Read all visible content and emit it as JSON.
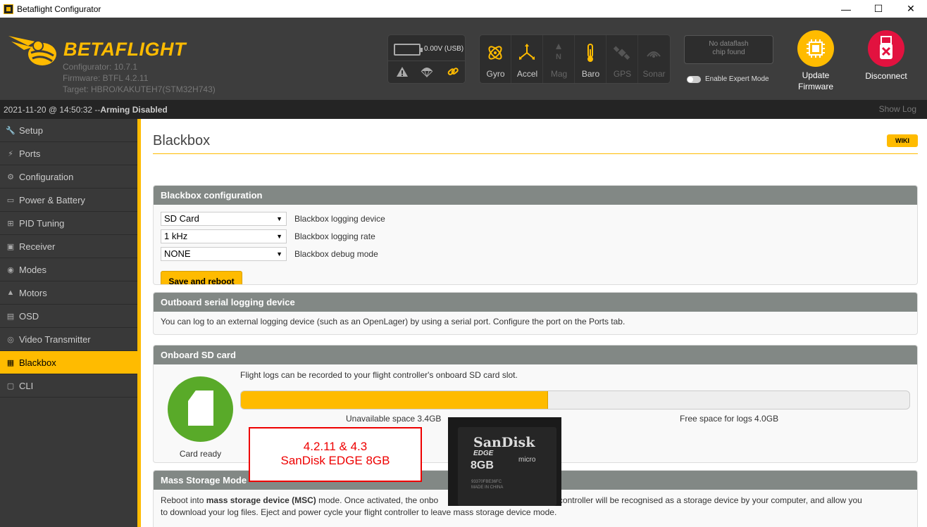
{
  "window": {
    "title": "Betaflight Configurator",
    "minimize": "—",
    "maximize": "☐",
    "close": "✕"
  },
  "header": {
    "logo_beta": "BETA",
    "logo_flight": "FLIGHT",
    "configurator": "Configurator: 10.7.1",
    "firmware": "Firmware: BTFL 4.2.11",
    "target": "Target: HBRO/KAKUTEH7(STM32H743)",
    "battery_voltage": "0.00V (USB)",
    "sensors": [
      {
        "label": "Gyro",
        "active": true
      },
      {
        "label": "Accel",
        "active": true
      },
      {
        "label": "Mag",
        "active": false
      },
      {
        "label": "Baro",
        "active": true
      },
      {
        "label": "GPS",
        "active": false
      },
      {
        "label": "Sonar",
        "active": false
      }
    ],
    "dataflash_line1": "No dataflash",
    "dataflash_line2": "chip found",
    "expert_mode": "Enable Expert Mode",
    "update_line1": "Update",
    "update_line2": "Firmware",
    "disconnect": "Disconnect"
  },
  "status": {
    "datetime": "2021-11-20 @ 14:50:32 -- ",
    "arming": "Arming Disabled",
    "show_log": "Show Log"
  },
  "sidebar": {
    "items": [
      {
        "label": "Setup",
        "icon": "wrench-icon"
      },
      {
        "label": "Ports",
        "icon": "plug-icon"
      },
      {
        "label": "Configuration",
        "icon": "gear-icon"
      },
      {
        "label": "Power & Battery",
        "icon": "battery-icon"
      },
      {
        "label": "PID Tuning",
        "icon": "sitemap-icon"
      },
      {
        "label": "Receiver",
        "icon": "receiver-icon"
      },
      {
        "label": "Modes",
        "icon": "toggles-icon"
      },
      {
        "label": "Motors",
        "icon": "motor-icon"
      },
      {
        "label": "OSD",
        "icon": "osd-icon"
      },
      {
        "label": "Video Transmitter",
        "icon": "broadcast-icon"
      },
      {
        "label": "Blackbox",
        "icon": "blackbox-icon"
      },
      {
        "label": "CLI",
        "icon": "terminal-icon"
      }
    ],
    "active": "Blackbox"
  },
  "main": {
    "title": "Blackbox",
    "wiki": "WIKI",
    "config": {
      "heading": "Blackbox configuration",
      "device_value": "SD Card",
      "device_label": "Blackbox logging device",
      "rate_value": "1 kHz",
      "rate_label": "Blackbox logging rate",
      "debug_value": "NONE",
      "debug_label": "Blackbox debug mode",
      "save_button": "Save and reboot"
    },
    "outboard": {
      "heading": "Outboard serial logging device",
      "text": "You can log to an external logging device (such as an OpenLager) by using a serial port. Configure the port on the Ports tab."
    },
    "sdcard": {
      "heading": "Onboard SD card",
      "text": "Flight logs can be recorded to your flight controller's onboard SD card slot.",
      "used_fraction": 0.4595,
      "unavailable": "Unavailable space 3.4GB",
      "free": "Free space for logs 4.0GB",
      "card_status": "Card ready"
    },
    "msc": {
      "heading": "Mass Storage Mode",
      "text_pre": "Reboot into ",
      "text_bold": "mass storage device (MSC)",
      "text_mid": " mode. Once activated, the onbo",
      "text_right": "flight controller will be recognised as a storage device by your computer, and allow you",
      "text_line2": "to download your log files. Eject and power cycle your flight controller to leave mass storage device mode."
    }
  },
  "annotation": {
    "line1": "4.2.11 & 4.3",
    "line2": "SanDisk EDGE 8GB"
  },
  "photo": {
    "brand": "SanDisk",
    "model": "EDGE",
    "capacity": "8GB",
    "micro": "micro",
    "fine1": "93370FBE36FC",
    "fine2": "MADE IN CHINA"
  },
  "colors": {
    "accent": "#ffbb00",
    "header_bg": "#3d3d3d",
    "sidebar_bg": "#393939",
    "panel_header": "#828885",
    "sd_green": "#59aa29",
    "disconnect_red": "#e2123f"
  }
}
